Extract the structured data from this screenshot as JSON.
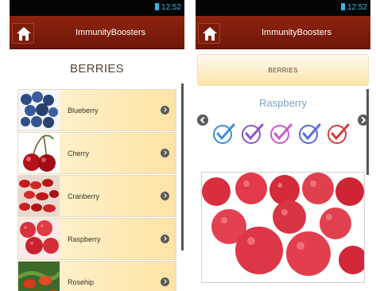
{
  "status_bar": {
    "time": "12:52"
  },
  "app": {
    "title": "ImmunityBoosters"
  },
  "left_screen": {
    "section_title": "BERRIES",
    "items": [
      {
        "label": "Blueberry",
        "image": "blueberry-photo"
      },
      {
        "label": "Cherry",
        "image": "cherry-photo"
      },
      {
        "label": "Cranberry",
        "image": "cranberry-photo"
      },
      {
        "label": "Raspberry",
        "image": "raspberry-photo"
      },
      {
        "label": "Rosehip",
        "image": "rosehip-photo"
      }
    ]
  },
  "right_screen": {
    "category": "BERRIES",
    "title": "Raspberry",
    "checkmarks": [
      {
        "color": "#3a8fd8"
      },
      {
        "color": "#8a55c8"
      },
      {
        "color": "#c95ac8"
      },
      {
        "color": "#5a68d8"
      },
      {
        "color": "#d83a3a"
      }
    ],
    "photo": "raspberry-photo"
  }
}
